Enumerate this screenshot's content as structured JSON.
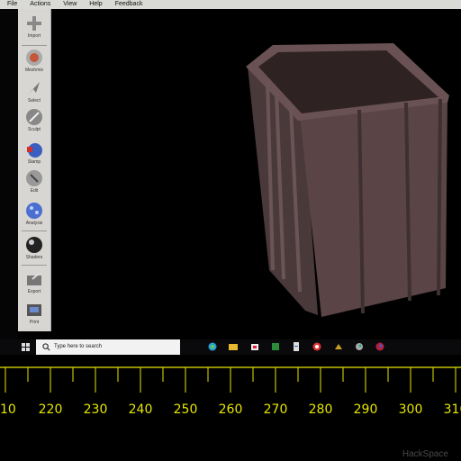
{
  "menu": [
    "File",
    "Actions",
    "View",
    "Help",
    "Feedback"
  ],
  "tools": [
    {
      "label": "Import",
      "icon": "plus-icon"
    },
    {
      "label": "Meshmix",
      "icon": "meshmix-icon"
    },
    {
      "label": "Select",
      "icon": "select-arrow-icon"
    },
    {
      "label": "Sculpt",
      "icon": "sculpt-brush-icon"
    },
    {
      "label": "Stamp",
      "icon": "stamp-icon"
    },
    {
      "label": "Edit",
      "icon": "edit-icon"
    },
    {
      "label": "Analysis",
      "icon": "analysis-sphere-icon"
    },
    {
      "label": "Shaders",
      "icon": "shaders-sphere-icon"
    },
    {
      "label": "Export",
      "icon": "export-icon"
    },
    {
      "label": "Print",
      "icon": "print-icon"
    }
  ],
  "taskbar": {
    "search_placeholder": "Type here to search"
  },
  "ruler": {
    "ticks": [
      "10",
      "220",
      "230",
      "240",
      "250",
      "260",
      "270",
      "280",
      "290",
      "300",
      "310"
    ]
  },
  "watermark": "HackSpace",
  "colors": {
    "ruler": "#e6e600",
    "model": "#5a4446",
    "toolbar": "#d8d6d2"
  }
}
